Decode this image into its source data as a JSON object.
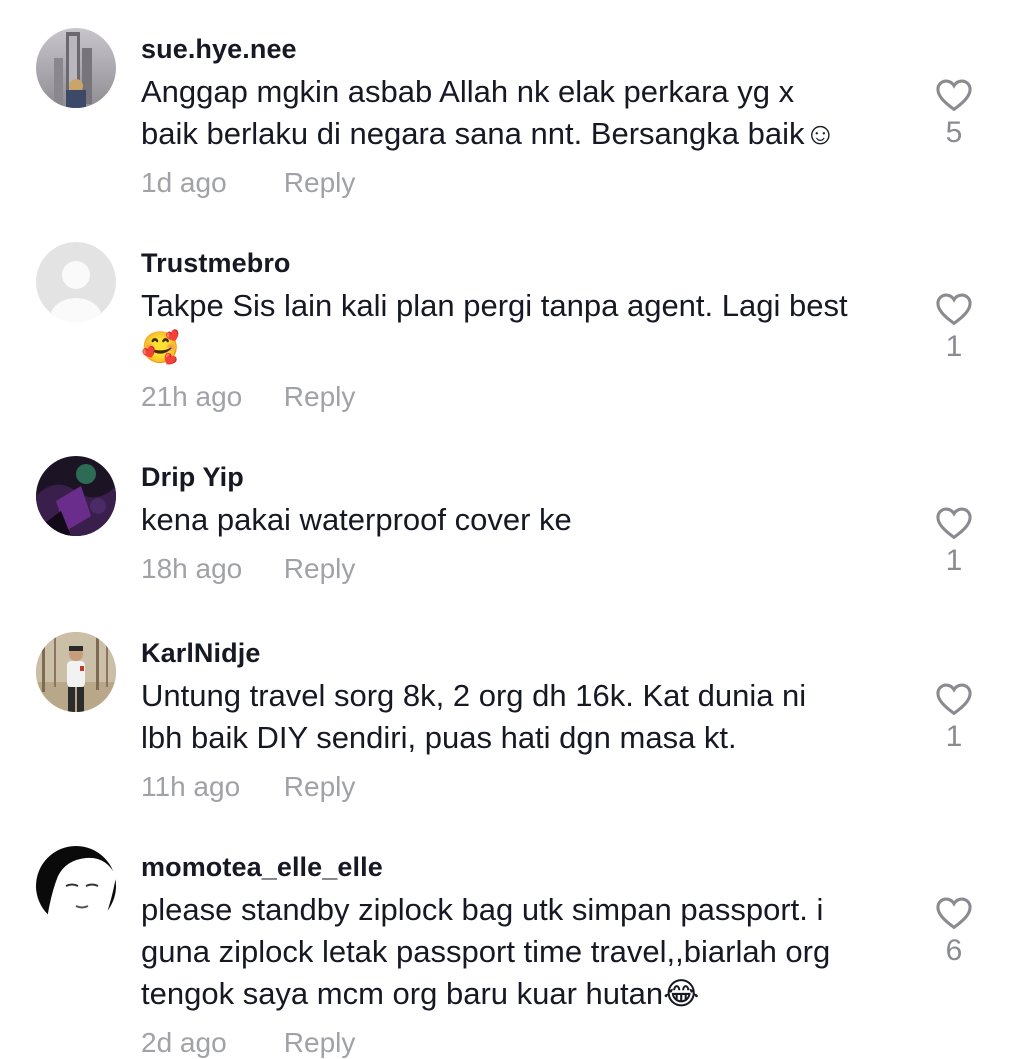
{
  "comments": [
    {
      "username": "sue.hye.nee",
      "text": "Anggap mgkin asbab Allah nk elak perkara yg x\nbaik berlaku di negara sana nnt. Bersangka baik☺",
      "time": "1d ago",
      "reply_label": "Reply",
      "likes": "5",
      "avatar_icon": "city-tower-photo-avatar"
    },
    {
      "username": "Trustmebro",
      "text": "Takpe Sis lain kali plan pergi tanpa agent. Lagi best\n🥰",
      "time": "21h ago",
      "reply_label": "Reply",
      "likes": "1",
      "avatar_icon": "default-person-avatar"
    },
    {
      "username": "Drip Yip",
      "text": "kena pakai waterproof cover ke",
      "time": "18h ago",
      "reply_label": "Reply",
      "likes": "1",
      "avatar_icon": "purple-dark-art-avatar"
    },
    {
      "username": "KarlNidje",
      "text": "Untung travel sorg 8k, 2 org dh 16k. Kat dunia ni\nlbh baik DIY sendiri, puas hati dgn masa kt.",
      "time": "11h ago",
      "reply_label": "Reply",
      "likes": "1",
      "avatar_icon": "person-in-forest-avatar"
    },
    {
      "username": "momotea_elle_elle",
      "text": "please standby ziplock bag utk simpan passport. i\nguna ziplock letak passport time travel,,biarlah org\ntengok saya mcm org baru kuar hutan😂",
      "time": "2d ago",
      "reply_label": "Reply",
      "likes": "6",
      "avatar_icon": "black-white-portrait-avatar"
    }
  ],
  "colors": {
    "text_primary": "#161823",
    "text_secondary": "#a1a2a7",
    "like_count": "#8a8b91",
    "heart_outline": "#8a8b91"
  }
}
